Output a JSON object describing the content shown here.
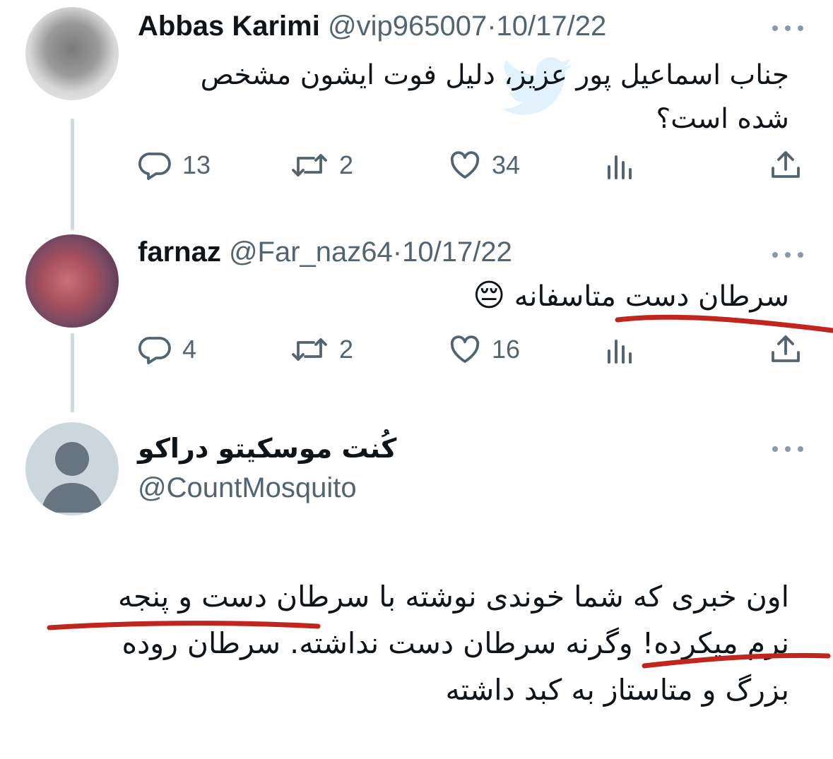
{
  "tweets": [
    {
      "name": "Abbas Karimi",
      "handle": "@vip965007",
      "separator": "·",
      "date": "10/17/22",
      "text_line1": "جناب اسماعیل پور عزیز، دلیل فوت ایشون مشخص",
      "text_line2": "شده است؟",
      "replies": "13",
      "retweets": "2",
      "likes": "34"
    },
    {
      "name": "farnaz",
      "handle": "@Far_naz64",
      "separator": "·",
      "date": "10/17/22",
      "text": "سرطان دست متاسفانه",
      "emoji": "😔",
      "replies": "4",
      "retweets": "2",
      "likes": "16"
    },
    {
      "name": "کُنت موسکیتو دراکو",
      "handle": "@CountMosquito",
      "text_line1": "اون خبری که شما خوندی نوشته با سرطان دست و پنجه",
      "text_line2": "نرم میکرده! وگرنه سرطان دست نداشته. سرطان روده",
      "text_line3": "بزرگ و متاستاز به کبد داشته"
    }
  ],
  "colors": {
    "text": "#0f1419",
    "secondary": "#536471",
    "icon": "#536471",
    "thread_line": "#cfd9de",
    "underline": "#c0261d"
  }
}
